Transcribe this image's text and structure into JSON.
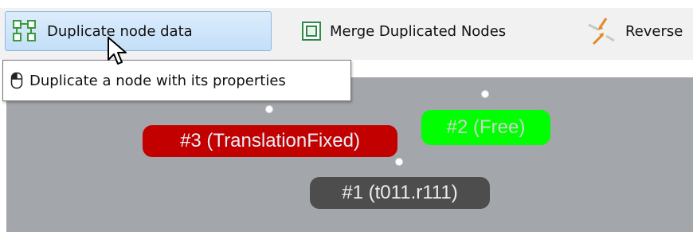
{
  "toolbar": {
    "duplicate_node_data_label": "Duplicate node data",
    "merge_duplicated_nodes_label": "Merge Duplicated Nodes",
    "reverse_label": "Reverse",
    "icons": [
      "duplicate-node-icon",
      "merge-nodes-icon",
      "reverse-icon"
    ]
  },
  "tooltip": {
    "text": "Duplicate a node with its properties",
    "icon": "mouse-icon"
  },
  "canvas": {
    "background": "#a3a6ab",
    "nodes": [
      {
        "id": "3",
        "label": "#3  (TranslationFixed)",
        "color": "#c30000"
      },
      {
        "id": "2",
        "label": "#2  (Free)",
        "color": "#00ff00"
      },
      {
        "id": "1",
        "label": "#1  (t011.r111)",
        "color": "#4d4d4d"
      }
    ]
  }
}
